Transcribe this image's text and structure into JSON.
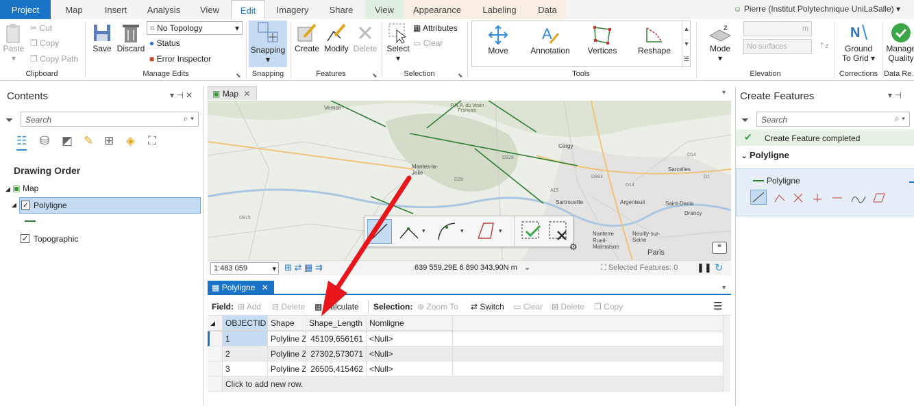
{
  "tabs": [
    "Project",
    "Map",
    "Insert",
    "Analysis",
    "View",
    "Edit",
    "Imagery",
    "Share",
    "View",
    "Appearance",
    "Labeling",
    "Data"
  ],
  "user": "Pierre (Institut Polytechnique UniLaSalle)",
  "clipboard": {
    "paste": "Paste",
    "cut": "Cut",
    "copy": "Copy",
    "copy_path": "Copy Path",
    "label": "Clipboard"
  },
  "manage_edits": {
    "save": "Save",
    "discard": "Discard",
    "topology": "No Topology",
    "status": "Status",
    "error_inspector": "Error Inspector",
    "label": "Manage Edits"
  },
  "snapping": {
    "button": "Snapping",
    "label": "Snapping"
  },
  "features": {
    "create": "Create",
    "modify": "Modify",
    "delete": "Delete",
    "label": "Features"
  },
  "selection": {
    "select": "Select",
    "attributes": "Attributes",
    "clear": "Clear",
    "label": "Selection"
  },
  "tools": {
    "move": "Move",
    "annotation": "Annotation",
    "vertices": "Vertices",
    "reshape": "Reshape",
    "label": "Tools"
  },
  "elevation": {
    "mode": "Mode",
    "unit": "m",
    "surfaces": "No surfaces",
    "label": "Elevation"
  },
  "corrections": {
    "ground": "Ground",
    "to_grid": "To Grid",
    "label": "Corrections"
  },
  "data_review": {
    "manage": "Manage",
    "quality": "Quality",
    "label": "Data Re..."
  },
  "contents": {
    "title": "Contents",
    "search_placeholder": "Search",
    "drawing_order": "Drawing Order",
    "map": "Map",
    "layer1": "Polyligne",
    "layer2": "Topographic"
  },
  "map_view": {
    "tab": "Map",
    "scale": "1:483 059",
    "coords": "639 559,29E 6 890 343,90N m",
    "selected": "Selected Features: 0",
    "places": [
      "Vernon",
      "P.N.R. du Vexin Français",
      "Mantes-la-Jolie",
      "Cergy",
      "Sarcelles",
      "Sartrouville",
      "Argenteuil",
      "Saint-Denis",
      "Drancy",
      "Nanterre",
      "Rueil-Malmaison",
      "Neuilly-sur-Seine",
      "Paris",
      "D915",
      "D14",
      "D928",
      "D983",
      "A15",
      "D14",
      "D1",
      "D28"
    ]
  },
  "attr_table": {
    "tab": "Polyligne",
    "field": "Field:",
    "add": "Add",
    "delete": "Delete",
    "calculate": "Calculate",
    "selection": "Selection:",
    "zoom": "Zoom To",
    "switch": "Switch",
    "clear": "Clear",
    "delete2": "Delete",
    "copy": "Copy",
    "columns": [
      "OBJECTID",
      "Shape",
      "Shape_Length",
      "Nomligne"
    ],
    "rows": [
      [
        "1",
        "Polyline Z",
        "45109,656161",
        "<Null>"
      ],
      [
        "2",
        "Polyline Z",
        "27302,573071",
        "<Null>"
      ],
      [
        "3",
        "Polyline Z",
        "26505,415462",
        "<Null>"
      ]
    ],
    "add_row": "Click to add new row."
  },
  "create_features": {
    "title": "Create Features",
    "search_placeholder": "Search",
    "status": "Create Feature completed",
    "group": "Polyligne",
    "template": "Polyligne"
  },
  "colors": {
    "accent": "#1a73c7",
    "select": "#c5dcf2",
    "arrow": "#e8161b",
    "line": "#2e7d32"
  }
}
